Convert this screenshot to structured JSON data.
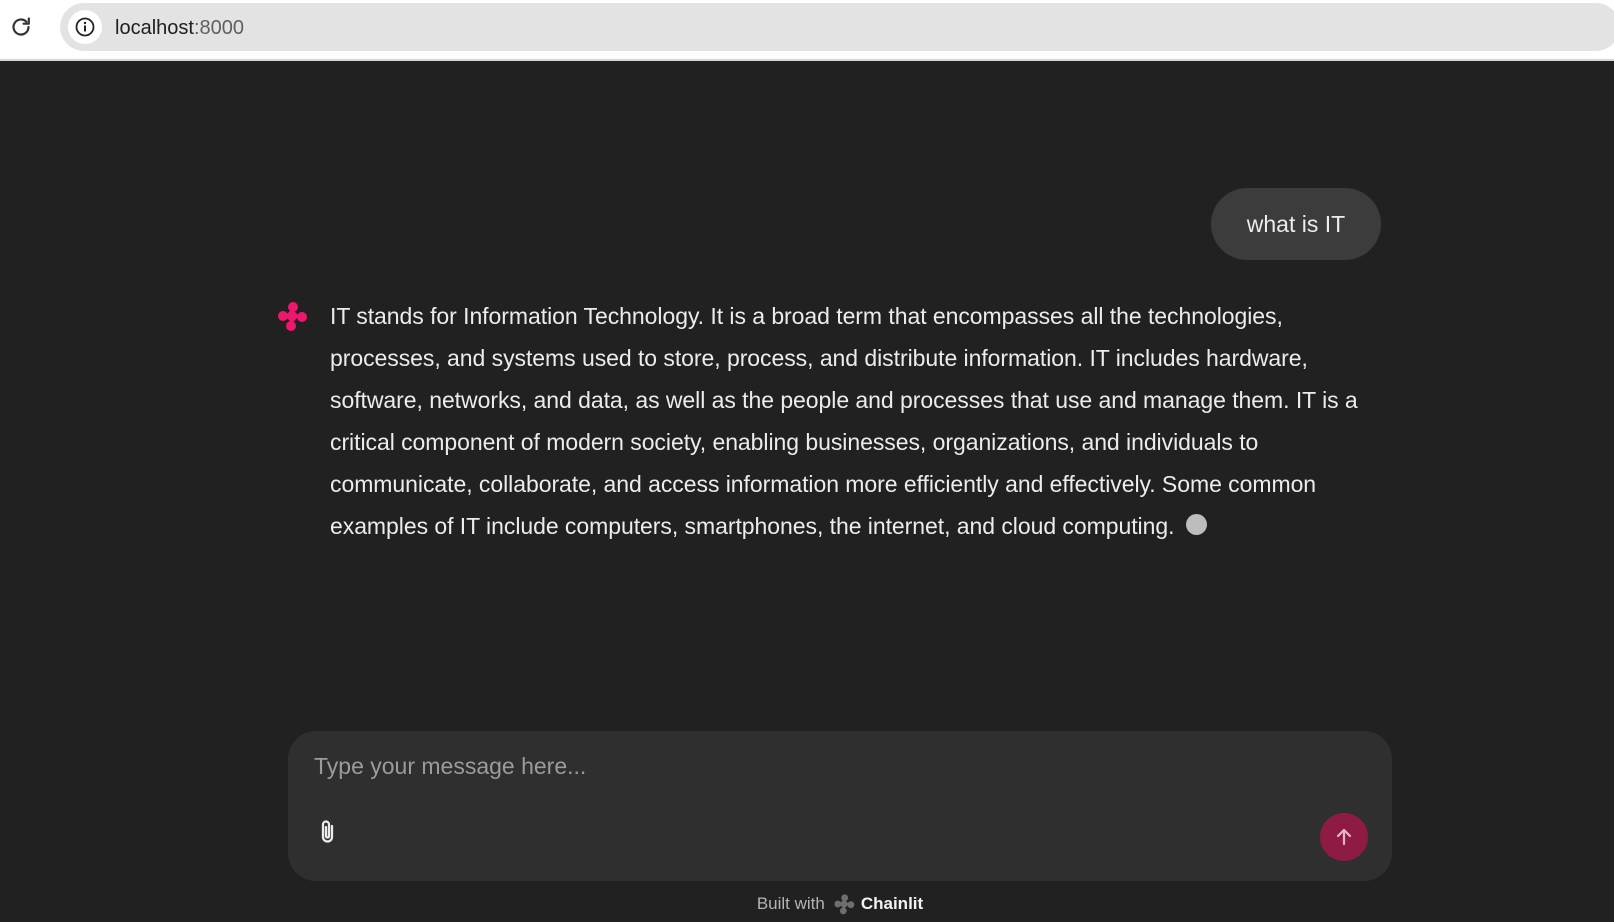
{
  "browser": {
    "url_host": "localhost",
    "url_port": ":8000"
  },
  "chat": {
    "user_message": "what is IT",
    "assistant_message": "IT stands for Information Technology. It is a broad term that encompasses all the technologies, processes, and systems used to store, process, and distribute information. IT includes hardware, software, networks, and data, as well as the people and processes that use and manage them. IT is a critical component of modern society, enabling businesses, organizations, and individuals to communicate, collaborate, and access information more efficiently and effectively. Some common examples of IT include computers, smartphones, the internet, and cloud computing."
  },
  "composer": {
    "placeholder": "Type your message here...",
    "attach_icon": "paperclip-icon",
    "send_icon": "arrow-up-icon"
  },
  "footer": {
    "built_with": "Built with",
    "brand": "Chainlit"
  },
  "colors": {
    "background": "#212121",
    "user_bubble": "#3c3c3c",
    "accent_pink": "#f0166d",
    "send_button": "#8e1b43"
  }
}
